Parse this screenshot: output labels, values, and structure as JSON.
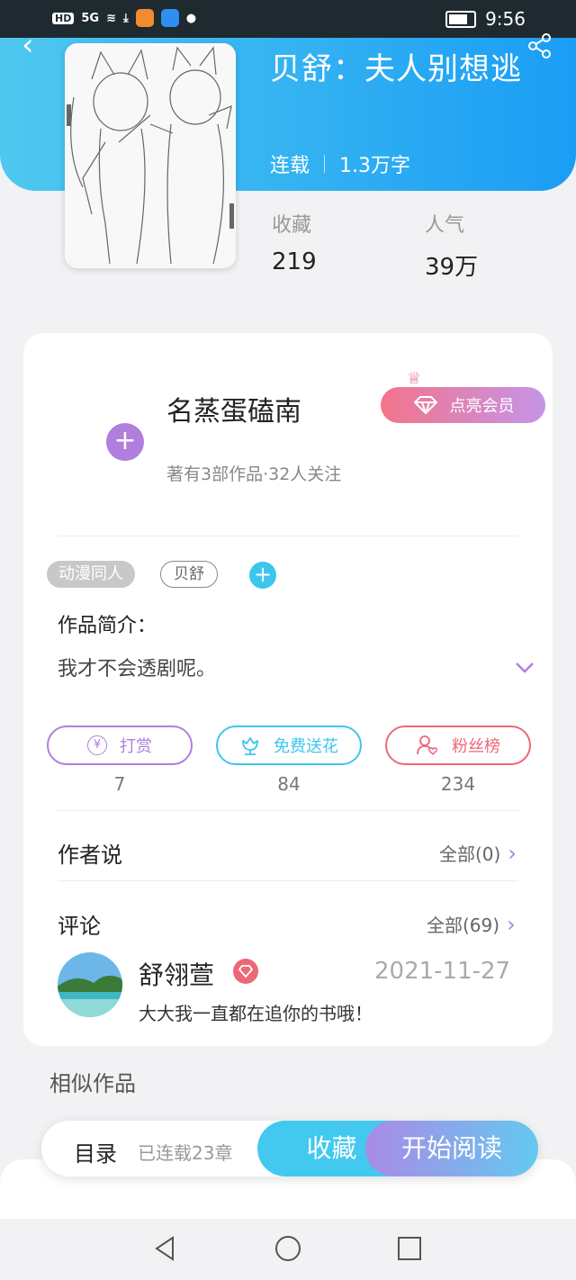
{
  "status_bar": {
    "network_badge": "HD",
    "signal": "5G",
    "time": "9:56"
  },
  "book": {
    "title": "贝舒：夫人别想逃",
    "status": "连载",
    "word_count": "1.3万字",
    "favorites_label": "收藏",
    "favorites_value": "219",
    "popularity_label": "人气",
    "popularity_value": "39万"
  },
  "author": {
    "name": "名蒸蛋磕南",
    "subtitle": "著有3部作品·32人关注",
    "vip_label": "点亮会员",
    "follow_symbol": "+"
  },
  "tags": {
    "items": [
      "动漫同人",
      "贝舒"
    ],
    "add_symbol": "+"
  },
  "intro": {
    "heading": "作品简介：",
    "text": "我才不会透剧呢。"
  },
  "actions": [
    {
      "label": "打赏",
      "count": "7",
      "color": "#b07edc"
    },
    {
      "label": "免费送花",
      "count": "84",
      "color": "#3cc6ee"
    },
    {
      "label": "粉丝榜",
      "count": "234",
      "color": "#ec6877"
    }
  ],
  "author_says": {
    "label": "作者说",
    "all": "全部(0)"
  },
  "comments": {
    "label": "评论",
    "all": "全部(69)",
    "item": {
      "name": "舒翎萱",
      "date": "2021-11-27",
      "text": "大大我一直都在追你的书哦！"
    }
  },
  "similar_label": "相似作品",
  "bottom_bar": {
    "catalog": "目录",
    "chapters": "已连载23章",
    "collect": "收藏",
    "read": "开始阅读"
  },
  "colors": {
    "header_start": "#4fc8f0",
    "header_end": "#1a9df4",
    "accent_purple": "#b07edc",
    "accent_blue": "#3cc6ee",
    "accent_red": "#ec6877"
  }
}
